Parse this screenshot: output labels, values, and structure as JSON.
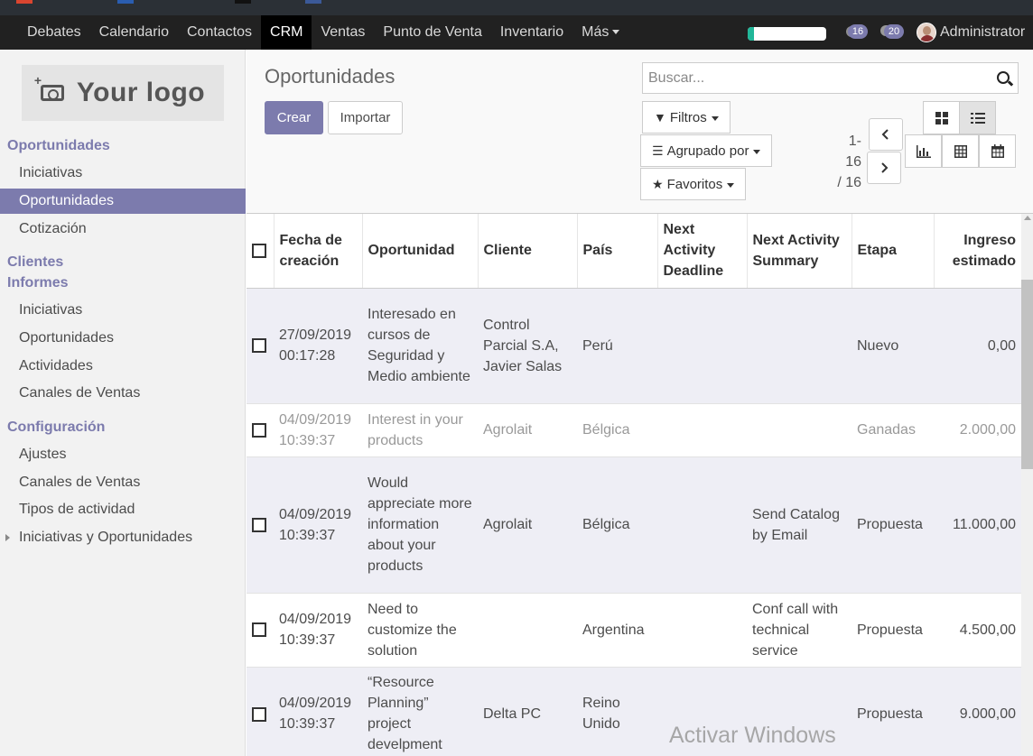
{
  "navbar": {
    "menu": [
      "Debates",
      "Calendario",
      "Contactos",
      "CRM",
      "Ventas",
      "Punto de Venta",
      "Inventario",
      "Más"
    ],
    "active": "CRM",
    "progress": 0.08,
    "badge_activities": "16",
    "badge_messages": "20",
    "user": "Administrator"
  },
  "sidebar": {
    "logo_text": "Your logo",
    "sections": {
      "oportunidades": "Oportunidades",
      "clientes": "Clientes",
      "informes": "Informes",
      "configuracion": "Configuración"
    },
    "items": {
      "iniciativas": "Iniciativas",
      "oportunidades": "Oportunidades",
      "cotizacion": "Cotización",
      "inf_iniciativas": "Iniciativas",
      "inf_oportunidades": "Oportunidades",
      "inf_actividades": "Actividades",
      "inf_canales": "Canales de Ventas",
      "conf_ajustes": "Ajustes",
      "conf_canales": "Canales de Ventas",
      "conf_tipos": "Tipos de actividad",
      "conf_inic_oport": "Iniciativas y Oportunidades"
    }
  },
  "control_panel": {
    "title": "Oportunidades",
    "create": "Crear",
    "import": "Importar",
    "search_placeholder": "Buscar...",
    "filters": "Filtros",
    "group_by": "Agrupado por",
    "favorites": "Favoritos",
    "pager_range": "1-16",
    "pager_total": "/ 16"
  },
  "table": {
    "headers": [
      "Fecha de creación",
      "Oportunidad",
      "Cliente",
      "País",
      "Next Activity Deadline",
      "Next Activity Summary",
      "Etapa",
      "Ingreso estimado"
    ],
    "rows": [
      {
        "fecha": "27/09/2019 00:17:28",
        "oportunidad": "Interesado en cursos de Seguridad y Medio ambiente",
        "cliente": "Control Parcial S.A, Javier Salas",
        "pais": "Perú",
        "deadline": "",
        "summary": "",
        "etapa": "Nuevo",
        "ingreso": "0,00"
      },
      {
        "fecha": "04/09/2019 10:39:37",
        "oportunidad": "Interest in your products",
        "cliente": "Agrolait",
        "pais": "Bélgica",
        "deadline": "",
        "summary": "",
        "etapa": "Ganadas",
        "ingreso": "2.000,00"
      },
      {
        "fecha": "04/09/2019 10:39:37",
        "oportunidad": "Would appreciate more information about your products",
        "cliente": "Agrolait",
        "pais": "Bélgica",
        "deadline": "",
        "summary": "Send Catalog by Email",
        "etapa": "Propuesta",
        "ingreso": "11.000,00"
      },
      {
        "fecha": "04/09/2019 10:39:37",
        "oportunidad": "Need to customize the solution",
        "cliente": "",
        "pais": "Argentina",
        "deadline": "",
        "summary": "Conf call with technical service",
        "etapa": "Propuesta",
        "ingreso": "4.500,00"
      },
      {
        "fecha": "04/09/2019 10:39:37",
        "oportunidad": "“Resource Planning” project develpment",
        "cliente": "Delta PC",
        "pais": "Reino Unido",
        "deadline": "",
        "summary": "",
        "etapa": "Propuesta",
        "ingreso": "9.000,00"
      }
    ]
  },
  "watermark": "Activar Windows",
  "colors": {
    "accent": "#7c7bad",
    "navbar": "#212121",
    "progress": "#21b799"
  }
}
